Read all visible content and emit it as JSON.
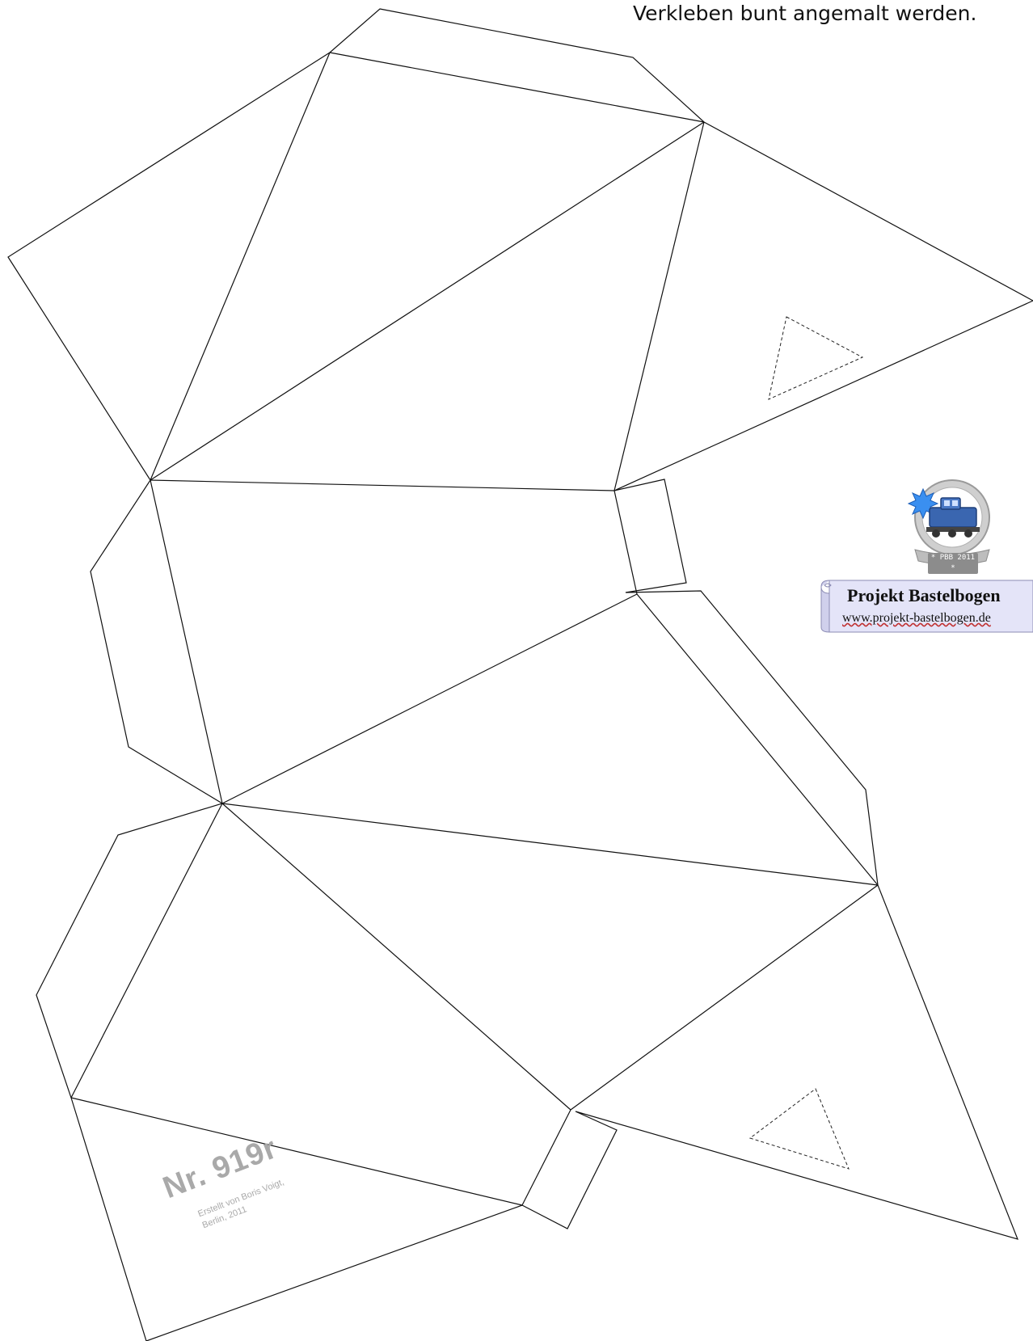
{
  "instruction": {
    "text": "Verkleben bunt angemalt werden."
  },
  "stamp": {
    "number": "Nr. 919r",
    "credit_line1": "Erstellt von Boris Voigt,",
    "credit_line2": "Berlin, 2011"
  },
  "logo": {
    "badge_text": "* PBB 2011 *",
    "icon": "locomotive-icon"
  },
  "banner": {
    "title": "Projekt Bastelbogen",
    "url": "www.projekt-bastelbogen.de"
  },
  "colors": {
    "line": "#111111",
    "stamp_gray": "#a9a9a9",
    "banner_fill": "#e4e4f8",
    "locomotive_blue": "#3a66b0"
  }
}
